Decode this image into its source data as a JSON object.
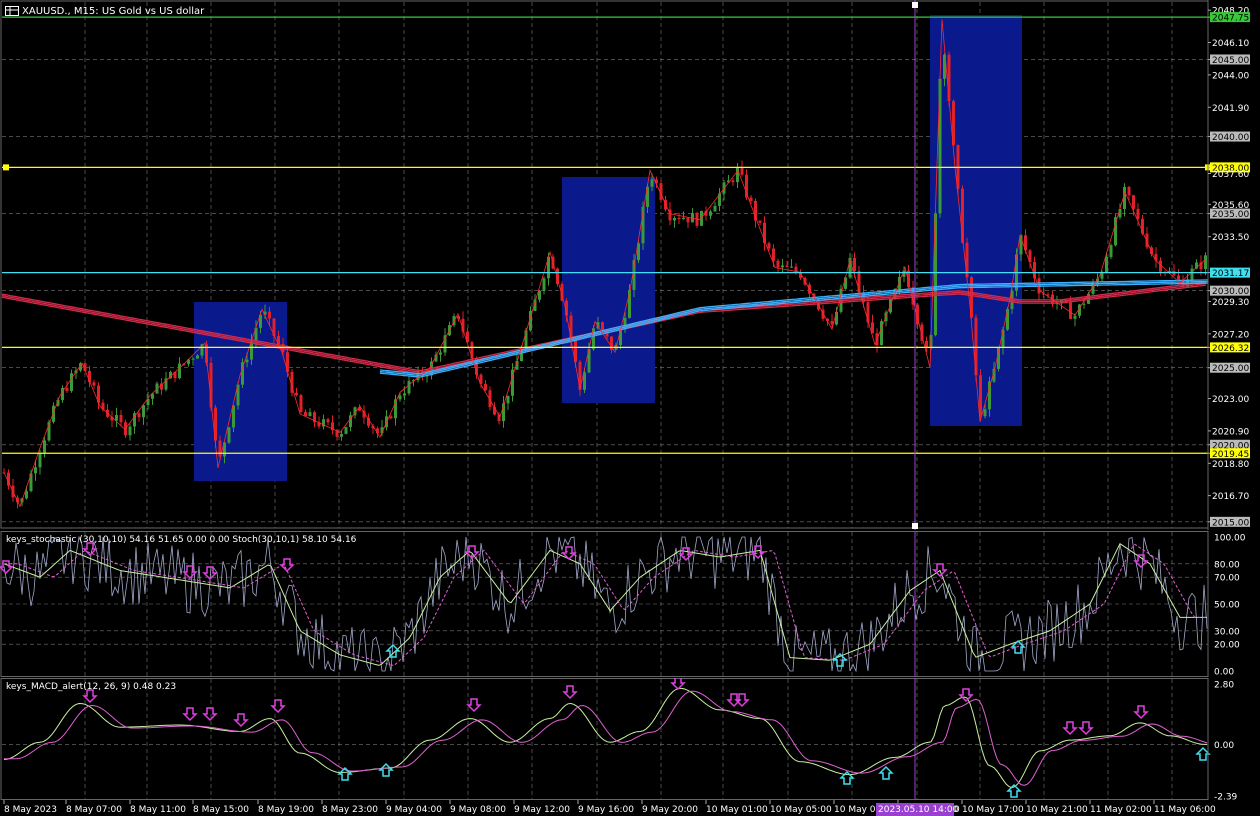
{
  "chart_title": "XAUUSD., M15: US Gold vs US dollar",
  "stoch_title": "keys_stochastic (30,10,10) 54.16 51.65 0.00 0.00 Stoch(30,10,1) 58.10 54.16",
  "macd_title": "keys_MACD_alert(12, 26, 9) 0.48 0.23",
  "price_labels": [
    "2048.20",
    "2047.75",
    "2046.10",
    "2045.00",
    "2044.00",
    "2041.90",
    "2040.00",
    "2038.00",
    "2037.60",
    "2035.60",
    "2035.00",
    "2033.50",
    "2031.17",
    "2030.00",
    "2029.30",
    "2027.20",
    "2026.32",
    "2025.00",
    "2023.00",
    "2020.90",
    "2020.00",
    "2019.45",
    "2018.80",
    "2016.70",
    "2015.00"
  ],
  "stoch_labels": [
    "100.00",
    "80.00",
    "70.00",
    "50.00",
    "30.00",
    "20.00",
    "0.00"
  ],
  "macd_labels": [
    "2.80",
    "0.00",
    "-2.39"
  ],
  "time_labels": [
    "8 May 2023",
    "8 May 07:00",
    "8 May 11:00",
    "8 May 15:00",
    "8 May 19:00",
    "8 May 23:00",
    "9 May 04:00",
    "9 May 08:00",
    "9 May 12:00",
    "9 May 16:00",
    "9 May 20:00",
    "10 May 01:00",
    "10 May 05:00",
    "10 May 09:00",
    "10 May 14:00",
    "10 May 17:00",
    "10 May 21:00",
    "11 May 02:00",
    "11 May 06:00"
  ],
  "crosshair_time": "2023.05.10 14:00",
  "colors": {
    "background": "#000000",
    "bull": "#3a9a3a",
    "bear": "#e0202a",
    "ma_red": "#d42a4a",
    "ma_blue": "#3ab0ff",
    "hline_yellow": "#ffff00",
    "hline_green": "#33cc33",
    "hline_cyan": "#40e0f0",
    "box": "#0a1a8c",
    "arrow_down": "#e040e0",
    "arrow_up": "#40e0f0",
    "crosshair": "#9a40d0"
  }
}
